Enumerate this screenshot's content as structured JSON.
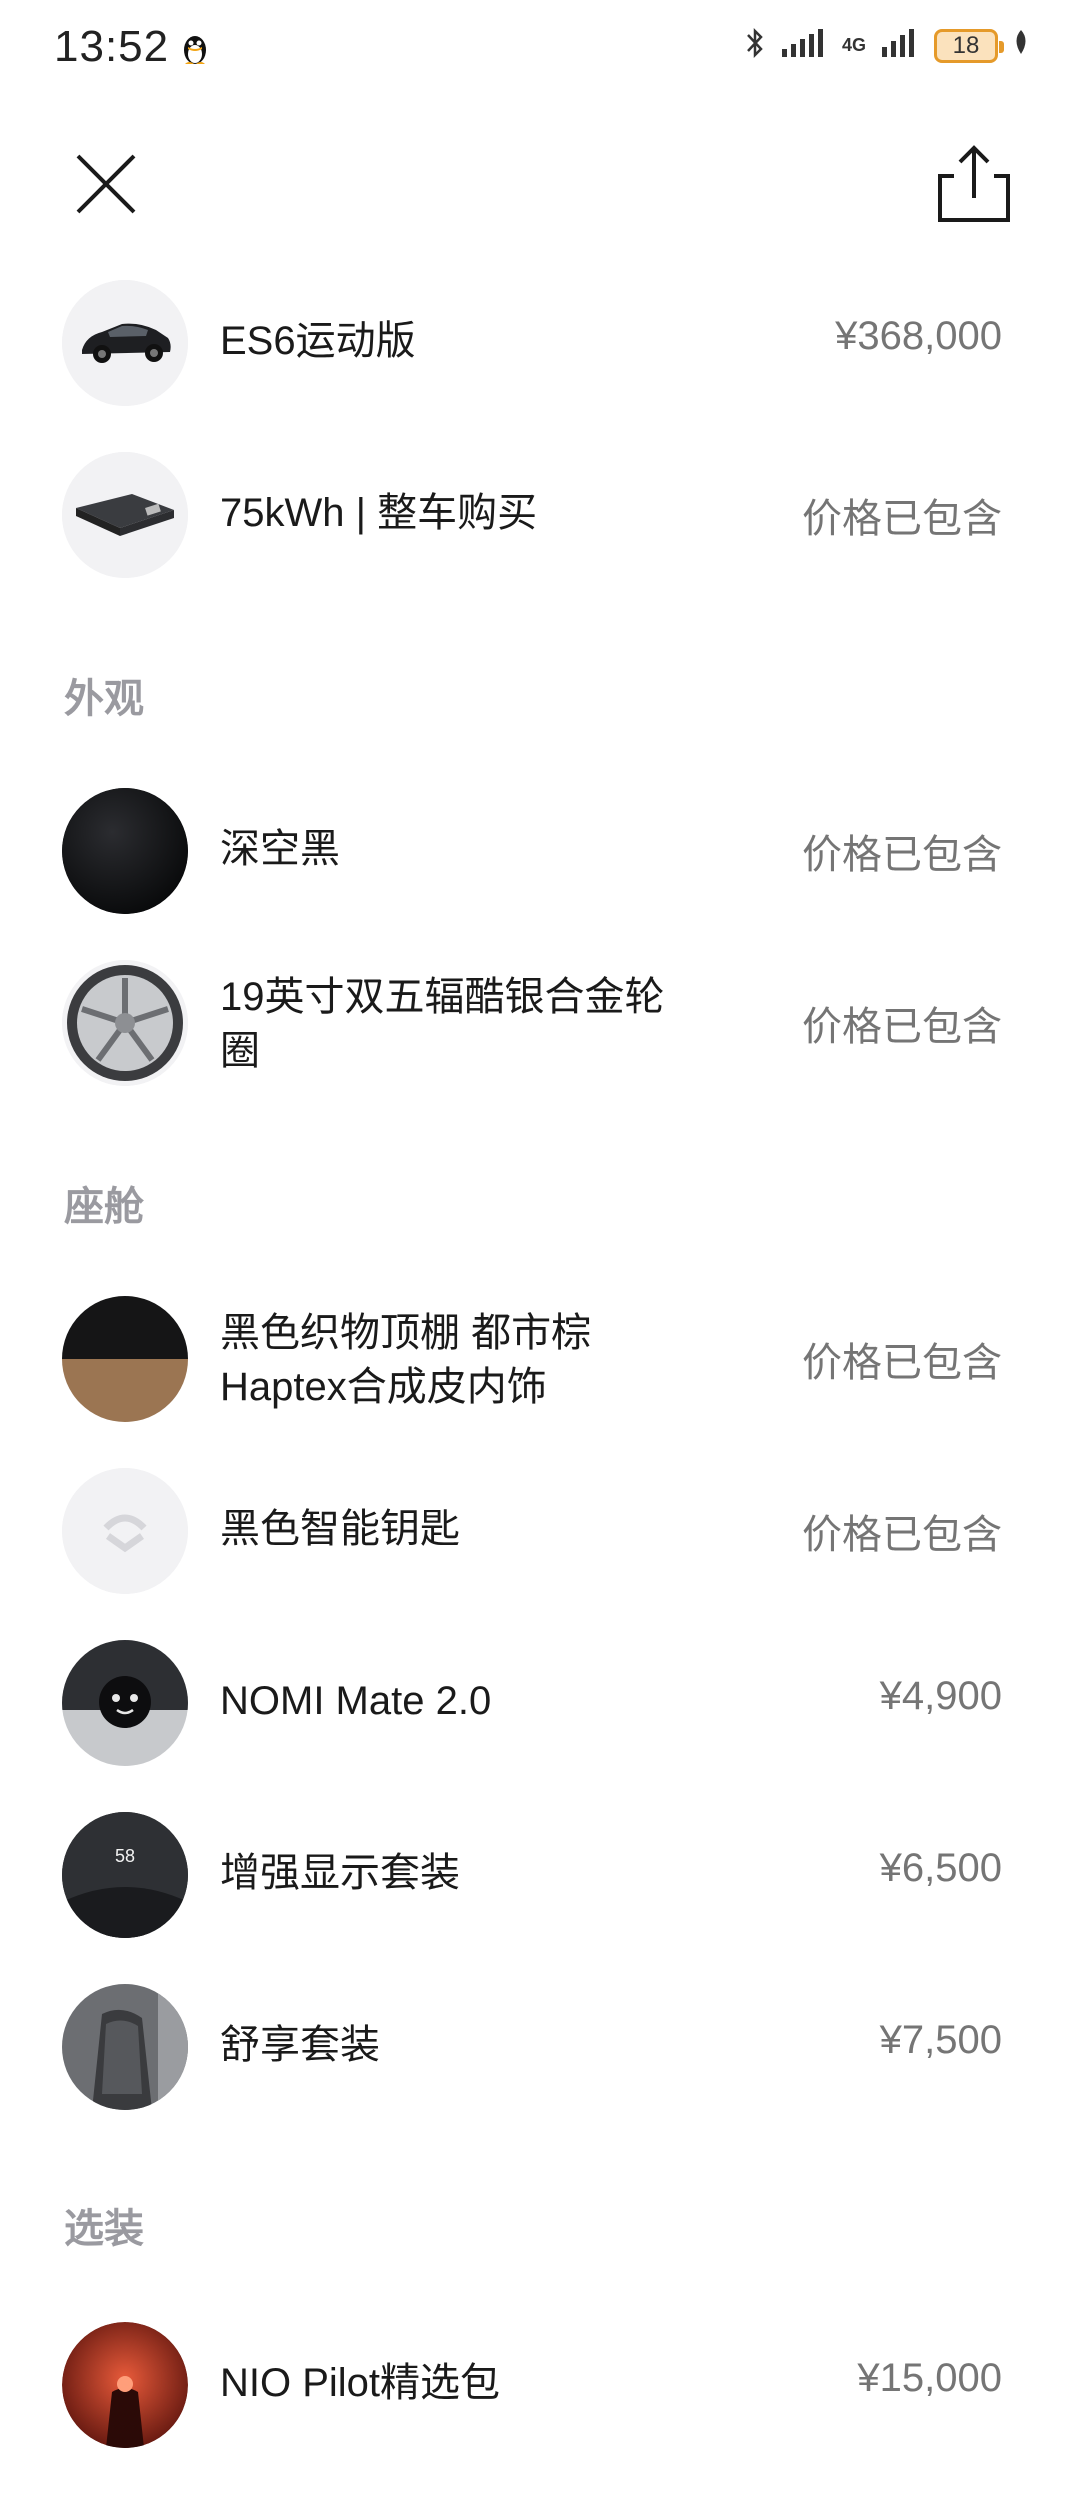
{
  "status_bar": {
    "time": "13:52",
    "battery": "18",
    "network": "4G"
  },
  "toolbar": {
    "close_icon": "close-icon",
    "share_icon": "share-icon"
  },
  "base": [
    {
      "name": "ES6运动版",
      "price": "¥368,000",
      "thumb": "car-icon"
    },
    {
      "name": "75kWh | 整车购买",
      "price": "价格已包含",
      "thumb": "battery-pack-icon"
    }
  ],
  "sections": {
    "exterior": "外观",
    "cabin": "座舱",
    "optional": "选装"
  },
  "exterior_items": [
    {
      "name": "深空黑",
      "price": "价格已包含"
    },
    {
      "name_line1": "19英寸双五辐酷银合金轮",
      "name_line2": "圈",
      "price": "价格已包含"
    }
  ],
  "cabin_items": [
    {
      "name_line1": "黑色织物顶棚 都市棕",
      "name_line2": "Haptex合成皮内饰",
      "price": "价格已包含"
    },
    {
      "name": "黑色智能钥匙",
      "price": "价格已包含"
    },
    {
      "name": "NOMI Mate 2.0",
      "price": "¥4,900"
    },
    {
      "name": "增强显示套装",
      "price": "¥6,500",
      "hud_speed": "58"
    },
    {
      "name": "舒享套装",
      "price": "¥7,500"
    }
  ],
  "optional_items": [
    {
      "name": "NIO Pilot精选包",
      "price": "¥15,000"
    }
  ]
}
